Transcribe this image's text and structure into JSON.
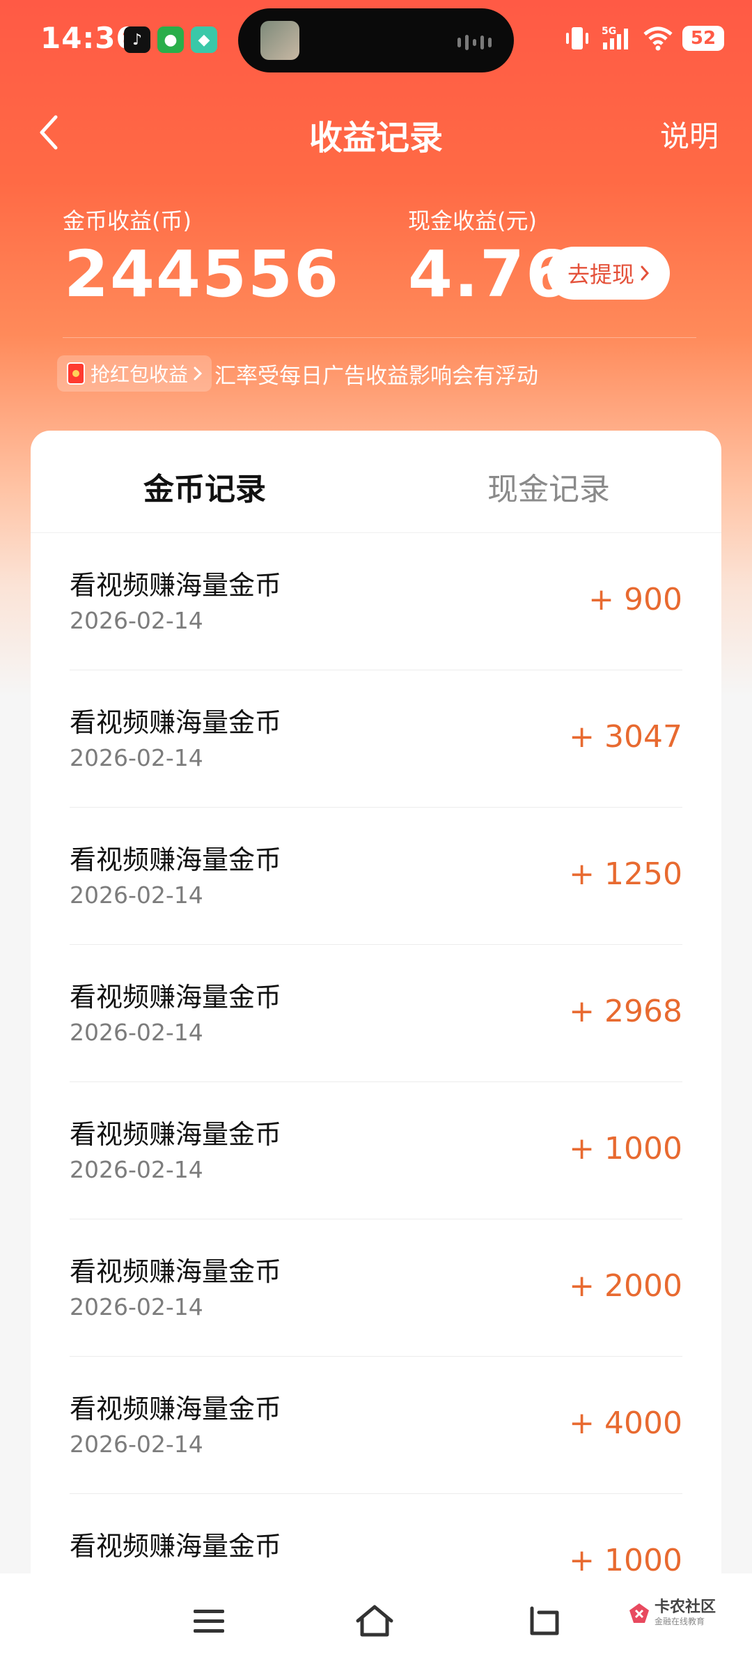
{
  "status_bar": {
    "time": "14:36",
    "network": "5G",
    "battery": "52"
  },
  "header": {
    "title": "收益记录",
    "explain": "说明"
  },
  "balances": {
    "coin_label": "金币收益(币)",
    "coin_value": "244556",
    "cash_label": "现金收益(元)",
    "cash_value": "4.76",
    "withdraw_label": "去提现"
  },
  "notice": {
    "tag": "抢红包收益",
    "text": "汇率受每日广告收益影响会有浮动"
  },
  "tabs": [
    {
      "label": "金币记录",
      "active": true
    },
    {
      "label": "现金记录",
      "active": false
    }
  ],
  "records": [
    {
      "title": "看视频赚海量金币",
      "date": "2026-02-14",
      "amount": "+ 900"
    },
    {
      "title": "看视频赚海量金币",
      "date": "2026-02-14",
      "amount": "+ 3047"
    },
    {
      "title": "看视频赚海量金币",
      "date": "2026-02-14",
      "amount": "+ 1250"
    },
    {
      "title": "看视频赚海量金币",
      "date": "2026-02-14",
      "amount": "+ 2968"
    },
    {
      "title": "看视频赚海量金币",
      "date": "2026-02-14",
      "amount": "+ 1000"
    },
    {
      "title": "看视频赚海量金币",
      "date": "2026-02-14",
      "amount": "+ 2000"
    },
    {
      "title": "看视频赚海量金币",
      "date": "2026-02-14",
      "amount": "+ 4000"
    },
    {
      "title": "看视频赚海量金币",
      "date": "",
      "amount": "+ 1000"
    }
  ],
  "watermark": {
    "name": "卡农社区",
    "sub": "金融在线教育"
  },
  "colors": {
    "accent": "#ff5a45",
    "amount": "#e86a30"
  }
}
